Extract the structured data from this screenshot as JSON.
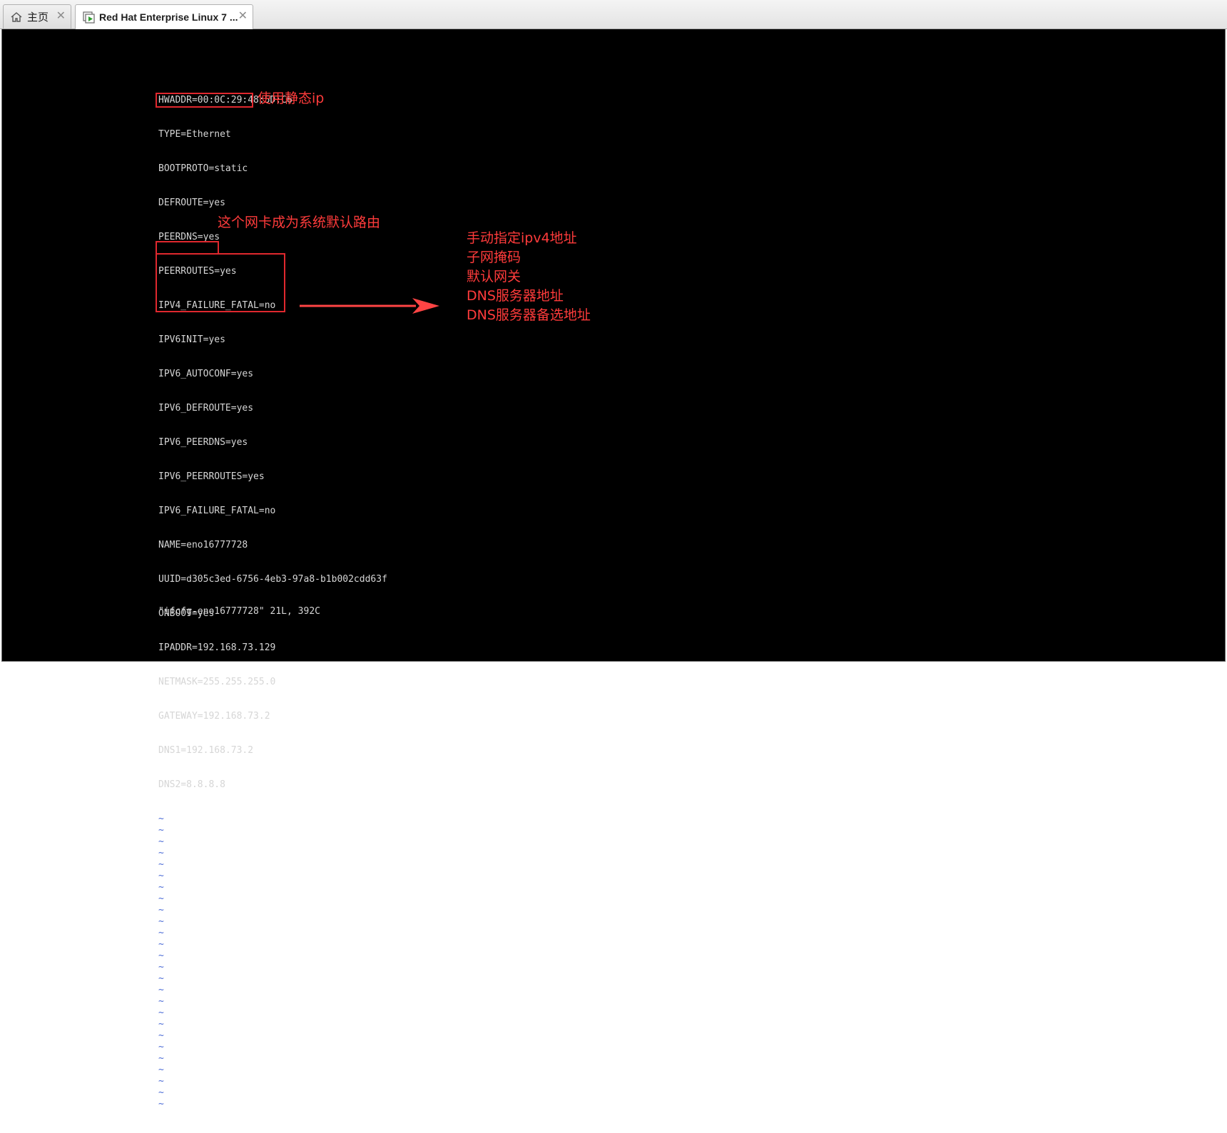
{
  "tabs": [
    {
      "label": "主页",
      "icon": "home-icon",
      "close": "✕"
    },
    {
      "label": "Red Hat Enterprise Linux 7 ...",
      "icon": "vm-play-icon",
      "close": "✕"
    }
  ],
  "file_lines": [
    "HWADDR=00:0C:29:48:5D:C6",
    "TYPE=Ethernet",
    "BOOTPROTO=static",
    "DEFROUTE=yes",
    "PEERDNS=yes",
    "PEERROUTES=yes",
    "IPV4_FAILURE_FATAL=no",
    "IPV6INIT=yes",
    "IPV6_AUTOCONF=yes",
    "IPV6_DEFROUTE=yes",
    "IPV6_PEERDNS=yes",
    "IPV6_PEERROUTES=yes",
    "IPV6_FAILURE_FATAL=no",
    "NAME=eno16777728",
    "UUID=d305c3ed-6756-4eb3-97a8-b1b002cdd63f",
    "ONBOOT=yes",
    "IPADDR=192.168.73.129",
    "NETMASK=255.255.255.0",
    "GATEWAY=192.168.73.2",
    "DNS1=192.168.73.2",
    "DNS2=8.8.8.8"
  ],
  "tilde_char": "~",
  "status_line": "\"ifcfg-eno16777728\" 21L, 392C",
  "annotations": {
    "bootproto_note": "使用静态ip",
    "onboot_note": "这个网卡成为系统默认路由",
    "ip_notes": [
      "手动指定ipv4地址",
      "子网掩码",
      "默认网关",
      "DNS服务器地址",
      "DNS服务器备选地址"
    ]
  },
  "colors": {
    "annotation": "#ff3b3b",
    "terminal_text": "#d6d6d6",
    "tilde": "#4b6bd6",
    "background": "#000000"
  }
}
